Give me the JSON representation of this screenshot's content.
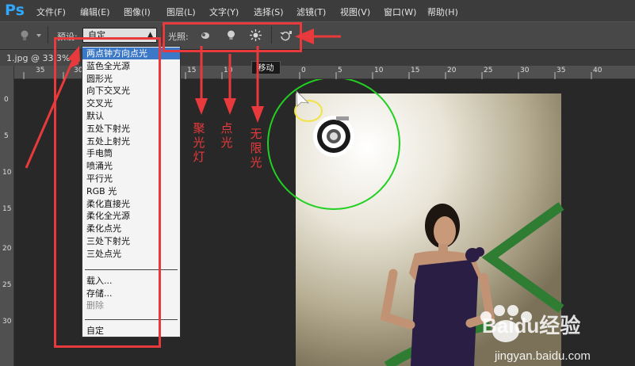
{
  "app": {
    "logo": "Ps"
  },
  "menubar": [
    {
      "label": "文件(F)",
      "name": "menu-file"
    },
    {
      "label": "编辑(E)",
      "name": "menu-edit"
    },
    {
      "label": "图像(I)",
      "name": "menu-image"
    },
    {
      "label": "图层(L)",
      "name": "menu-layer"
    },
    {
      "label": "文字(Y)",
      "name": "menu-type"
    },
    {
      "label": "选择(S)",
      "name": "menu-select"
    },
    {
      "label": "滤镜(T)",
      "name": "menu-filter"
    },
    {
      "label": "视图(V)",
      "name": "menu-view"
    },
    {
      "label": "窗口(W)",
      "name": "menu-window"
    },
    {
      "label": "帮助(H)",
      "name": "menu-help"
    }
  ],
  "options": {
    "preset_label": "预设:",
    "preset_value": "自定",
    "light_label": "光照:",
    "tooltip": "移动"
  },
  "document": {
    "tab_title": "1.jpg @ 33.3%"
  },
  "ruler": {
    "h_labels": [
      "35",
      "30",
      "15",
      "10",
      "0",
      "5",
      "10",
      "15",
      "20",
      "25",
      "30",
      "35",
      "40"
    ],
    "v_labels": [
      "0",
      "5",
      "10",
      "15",
      "20",
      "25",
      "30"
    ]
  },
  "preset_menu": {
    "items": [
      "两点钟方向点光",
      "蓝色全光源",
      "圆形光",
      "向下交叉光",
      "交叉光",
      "默认",
      "五处下射光",
      "五处上射光",
      "手电筒",
      "喷涌光",
      "平行光",
      "RGB 光",
      "柔化直接光",
      "柔化全光源",
      "柔化点光",
      "三处下射光",
      "三处点光"
    ],
    "actions": [
      "载入...",
      "存储...",
      "删除"
    ],
    "custom": "自定"
  },
  "annotations": {
    "spot": "聚光灯",
    "point": "点光",
    "infinite": "无限光"
  },
  "watermark": {
    "brand": "Baidu经验",
    "url": "jingyan.baidu.com"
  },
  "colors": {
    "accent": "#3c78c8",
    "annotation": "#e8393c",
    "ps_blue": "#31a8ff",
    "guide_green": "#22d022"
  }
}
